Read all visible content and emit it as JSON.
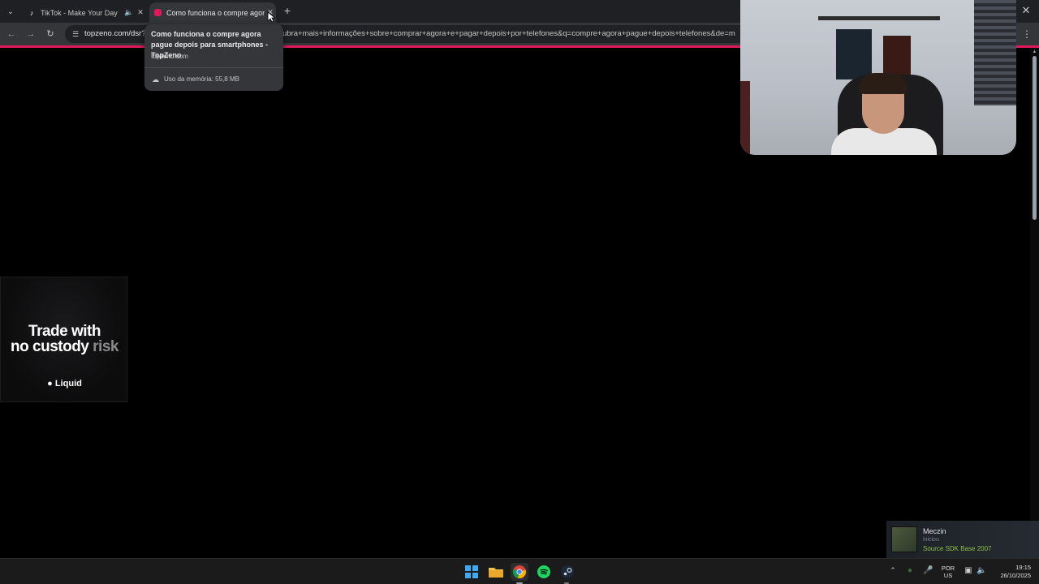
{
  "browser": {
    "tabs": [
      {
        "title": "TikTok - Make Your Day",
        "favicon": "tiktok-icon",
        "audio_icon": "speaker-icon"
      },
      {
        "title": "Como funciona o compre agora",
        "favicon": "topzeno-icon",
        "active": true
      }
    ],
    "url_prefix": "topzeno.com/dsr?",
    "url_rest": "ubra+mais+informações+sobre+comprar+agora+e+pagar+depois+por+telefones&q=compre+agora+pague+depois+telefones&de=m",
    "accent_color": "#e0195a"
  },
  "tooltip": {
    "title": "Como funciona o compre agora pague depois para smartphones - TopZeno",
    "domain": "topzeno.com",
    "memory": "Uso da memória: 55,8 MB"
  },
  "ad": {
    "line1": "Trade with",
    "line2a": "no custody",
    "line2b": "risk",
    "brand": "Liquid"
  },
  "notification": {
    "name": "Meczin",
    "status": "iniciou",
    "game": "Source SDK Base 2007"
  },
  "taskbar": {
    "apps": [
      "windows-start-icon",
      "file-explorer-icon",
      "chrome-icon",
      "spotify-icon",
      "steam-icon"
    ],
    "lang_line1": "POR",
    "lang_line2": "US",
    "time": "19:15",
    "date": "26/10/2025"
  }
}
